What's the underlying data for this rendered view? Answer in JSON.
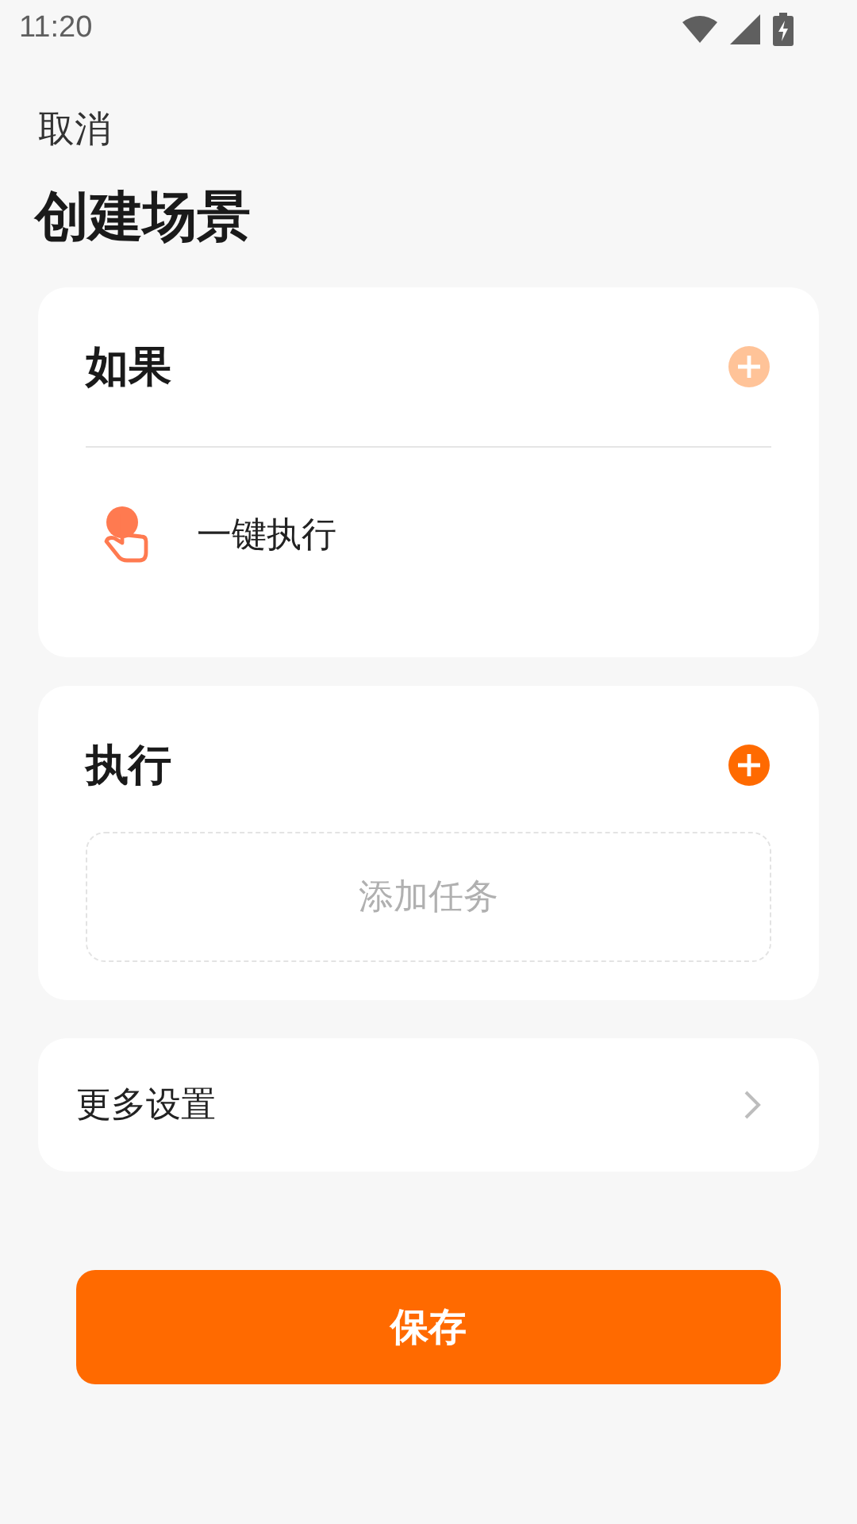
{
  "status_bar": {
    "time": "11:20"
  },
  "header": {
    "cancel": "取消",
    "title": "创建场景"
  },
  "condition_card": {
    "title": "如果",
    "add_disabled": true,
    "items": [
      {
        "label": "一键执行"
      }
    ]
  },
  "action_card": {
    "title": "执行",
    "add_disabled": false,
    "placeholder": "添加任务"
  },
  "more_settings": {
    "label": "更多设置"
  },
  "save_button": {
    "label": "保存"
  }
}
